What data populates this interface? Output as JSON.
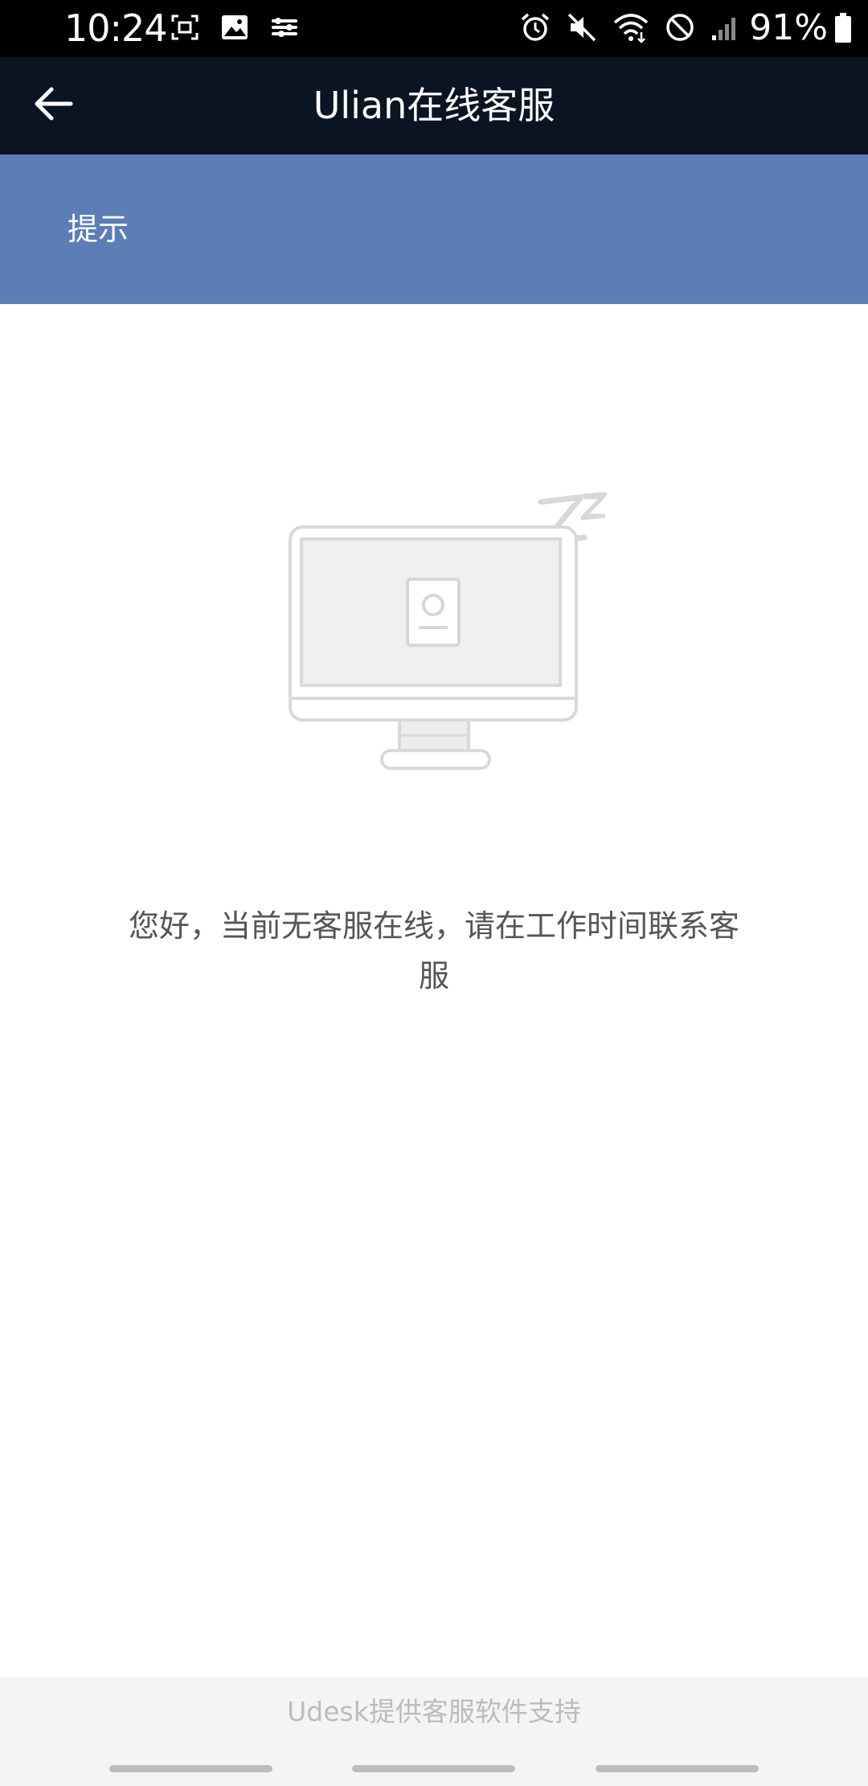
{
  "status_bar": {
    "time": "10:24",
    "battery_percent": "91%",
    "left_icons": [
      "screen-record-icon",
      "image-icon",
      "tune-icon"
    ],
    "right_icons": [
      "alarm-icon",
      "mute-icon",
      "wifi-icon",
      "do-not-disturb-icon",
      "signal-icon",
      "battery-icon"
    ]
  },
  "app_bar": {
    "title": "Ulian在线客服",
    "back_icon": "arrow-left-icon"
  },
  "notice": {
    "title": "提示"
  },
  "empty_state": {
    "illustration_icon": "sleeping-monitor-icon",
    "message": "您好，当前无客服在线，请在工作时间联系客服"
  },
  "footer": {
    "text": "Udesk提供客服软件支持"
  },
  "colors": {
    "status_bar_bg": "#000000",
    "app_bar_bg": "#0a1422",
    "notice_bg": "#5d7db6",
    "footer_bg": "#f4f4f4",
    "footer_text": "#bcbcbc",
    "message_text": "#555555"
  }
}
